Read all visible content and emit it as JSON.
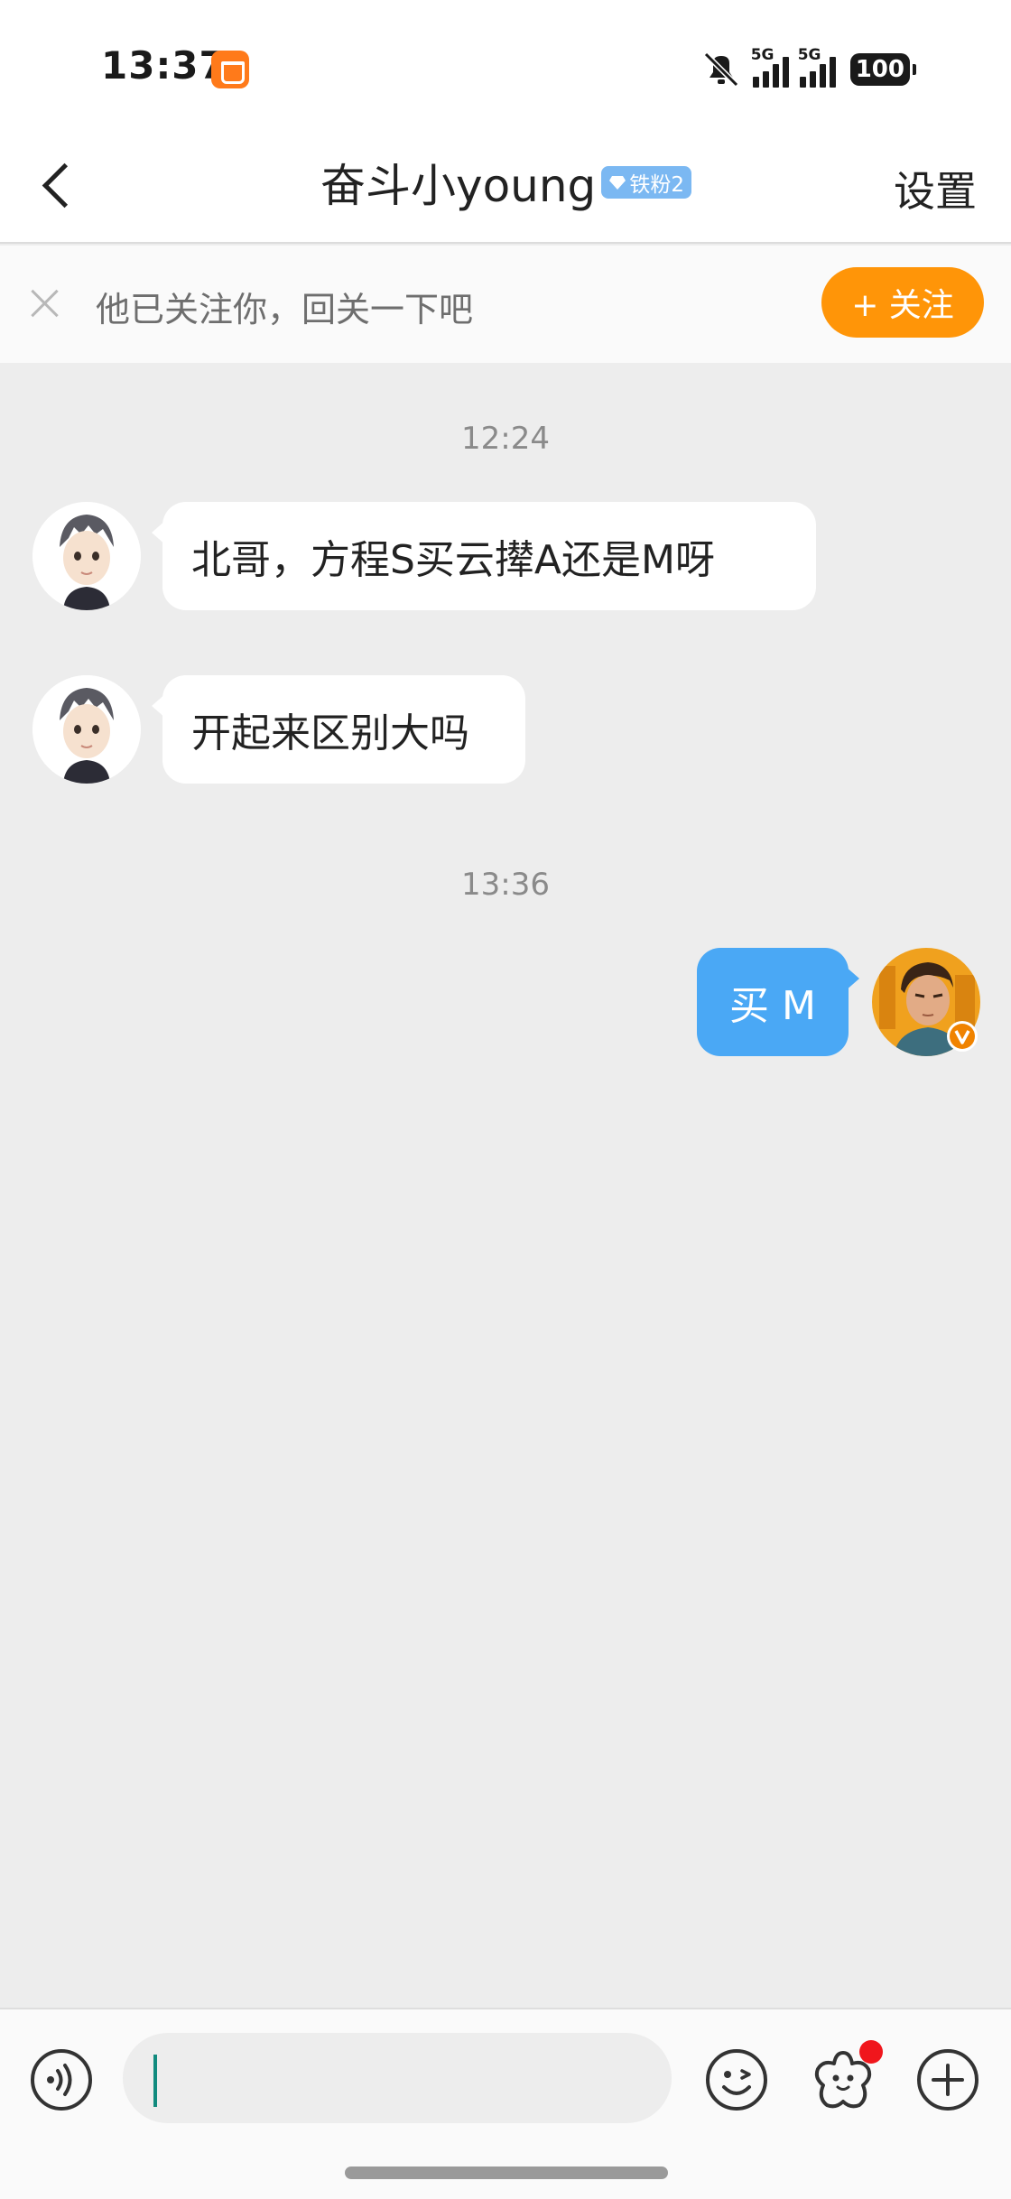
{
  "status_bar": {
    "time": "13:37",
    "network_1": "5G",
    "network_2": "5G",
    "battery": "100"
  },
  "header": {
    "title": "奋斗小young",
    "fan_badge": "铁粉2",
    "settings_label": "设置"
  },
  "follow_banner": {
    "text": "他已关注你，回关一下吧",
    "follow_button_label": "+ 关注"
  },
  "messages": {
    "time_1": "12:24",
    "msg_1": "北哥，方程S买云撵A还是M呀",
    "msg_2": "开起来区别大吗",
    "time_2": "13:36",
    "msg_3": "买 M"
  },
  "colors": {
    "accent_orange": "#ff9508",
    "bubble_blue": "#4aa8f5",
    "badge_blue": "#7bb8f2",
    "notification_red": "#f0161c"
  },
  "icons": [
    "back-icon",
    "close-icon",
    "voice-icon",
    "emoji-icon",
    "sticker-icon",
    "plus-icon",
    "verified-icon"
  ]
}
